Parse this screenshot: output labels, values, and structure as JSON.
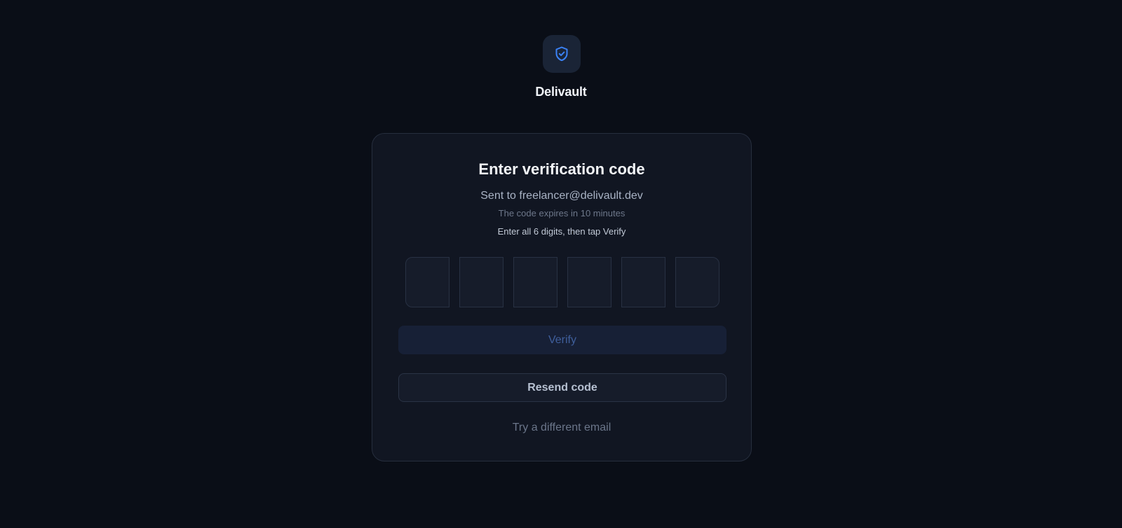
{
  "app": {
    "brand_name": "Delivault",
    "logo_icon": "shield-check-icon",
    "accent_color": "#3b82f6"
  },
  "card": {
    "title": "Enter verification code",
    "sent_to": "Sent to freelancer@delivault.dev",
    "expires_note": "The code expires in 10 minutes",
    "instructions": "Enter all 6 digits, then tap Verify"
  },
  "otp": {
    "digits": [
      "",
      "",
      "",
      "",
      "",
      ""
    ]
  },
  "actions": {
    "verify_label": "Verify",
    "resend_label": "Resend code",
    "different_email_label": "Try a different email"
  }
}
